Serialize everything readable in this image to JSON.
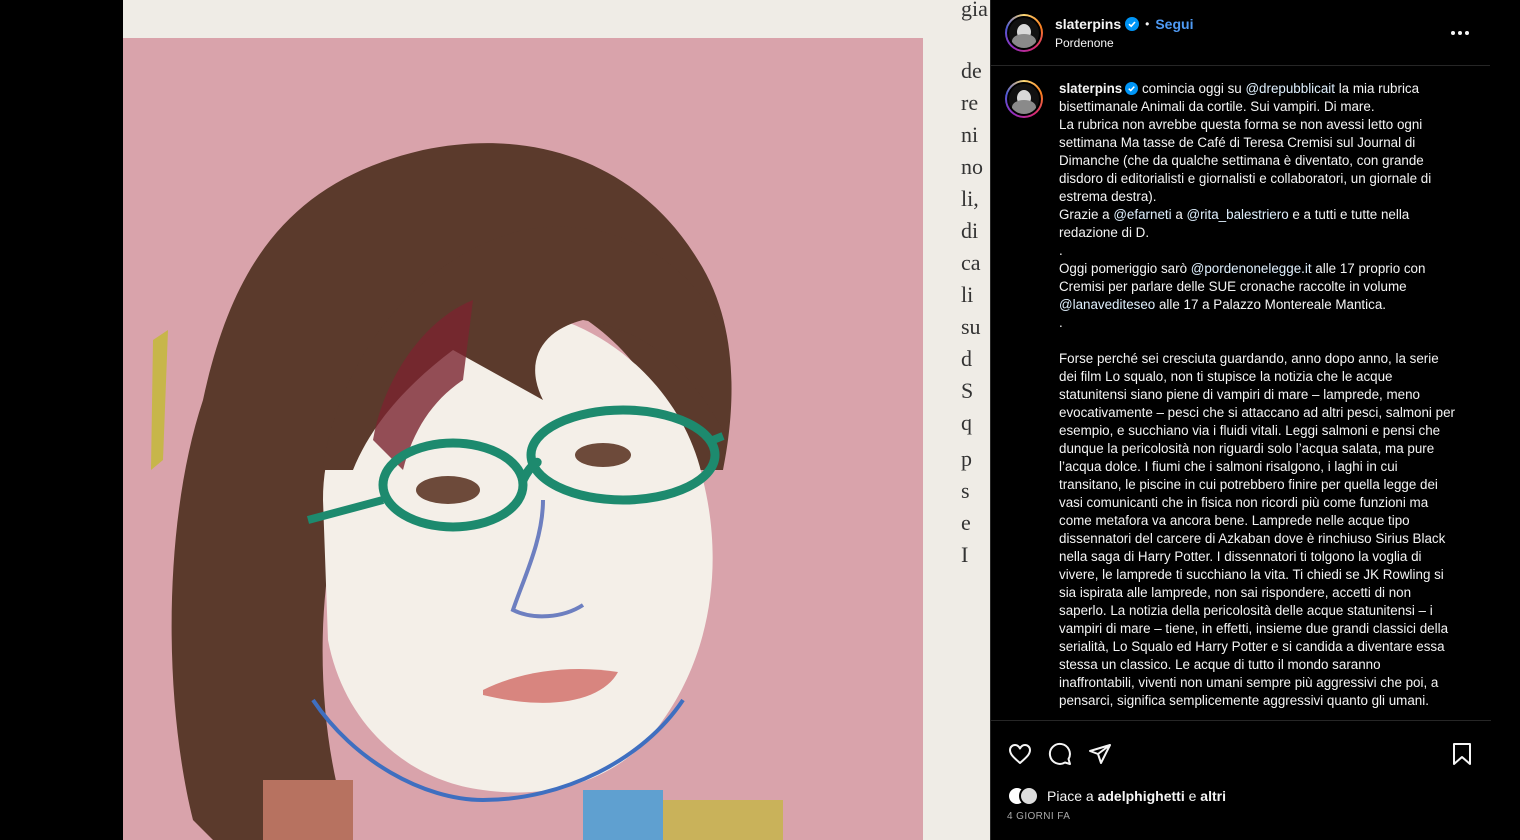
{
  "post": {
    "username": "slaterpins",
    "separator": "•",
    "follow_label": "Segui",
    "location": "Pordenone",
    "more_icon": "more-horizontal-icon"
  },
  "caption": {
    "username": "slaterpins",
    "text_1": " comincia oggi su ",
    "mention_1": "@drepubblicait",
    "text_2": " la mia rubrica bisettimanale Animali da cortile. Sui vampiri. Di mare.\nLa rubrica non avrebbe questa forma se non avessi letto ogni settimana Ma tasse de Café di Teresa Cremisi sul Journal di Dimanche (che da qualche settimana è diventato, con grande disdoro di editorialisti e giornalisti e collaboratori, un giornale di estrema destra).\nGrazie a ",
    "mention_2": "@efarneti",
    "text_3": " a ",
    "mention_3": "@rita_balestriero",
    "text_4": " e a tutti e tutte nella redazione di D.\n.\nOggi pomeriggio sarò ",
    "mention_4": "@pordenonelegge.it",
    "text_5": " alle 17 proprio con Cremisi per parlare delle SUE cronache raccolte in volume ",
    "mention_5": "@lanavediteseo",
    "text_6": " alle 17 a Palazzo Montereale Mantica.\n.\n\nForse perché sei cresciuta guardando, anno dopo anno, la serie dei film Lo squalo, non ti stupisce la notizia che le acque statunitensi siano piene di vampiri di mare – lamprede, meno evocativamente – pesci che si attaccano ad altri pesci, salmoni per esempio, e succhiano via i fluidi vitali. Leggi salmoni e pensi che dunque la pericolosità non riguardi solo l’acqua salata, ma pure l’acqua dolce. I fiumi che i salmoni risalgono, i laghi in cui transitano, le piscine in cui potrebbero finire per quella legge dei vasi comunicanti che in fisica non ricordi più come funzioni ma come metafora va ancora bene. Lamprede nelle acque tipo dissennatori del carcere di Azkaban dove è rinchiuso Sirius Black nella saga di Harry Potter. I dissennatori ti tolgono la voglia di vivere, le lamprede ti succhiano la vita. Ti chiedi se JK Rowling si sia ispirata alle lamprede, non sai rispondere, accetti di non saperlo. La notizia della pericolosità delle acque statunitensi – i vampiri di mare – tiene, in effetti, insieme due grandi classici della serialità, Lo Squalo ed Harry Potter e si candida a diventare essa stessa un classico. Le acque di tutto il mondo saranno inaffrontabili, viventi non umani sempre più aggressivi che poi, a pensarci, significa semplicemente aggressivi quanto gli umani."
  },
  "actions": {
    "like_icon": "heart-icon",
    "comment_icon": "comment-icon",
    "share_icon": "share-icon",
    "save_icon": "bookmark-icon"
  },
  "likes": {
    "prefix": "Piace a ",
    "user": "adelphighetti",
    "middle": " e ",
    "others": "altri"
  },
  "time_ago": "4 GIORNI FA",
  "media": {
    "newspaper_fragments": [
      "gia",
      "de",
      "re",
      "ni",
      "no",
      "li,",
      "di",
      "ca",
      "li",
      "su",
      "d",
      "S",
      "q",
      "p",
      "s",
      "e",
      "I"
    ],
    "colors": {
      "pink_bg": "#d9a3ab",
      "hair": "#5b3a2c",
      "glasses": "#1d8a6e",
      "paper": "#efece6"
    }
  },
  "colors": {
    "accent": "#4f9bf5",
    "panel_bg": "#000000",
    "border": "#262626"
  }
}
